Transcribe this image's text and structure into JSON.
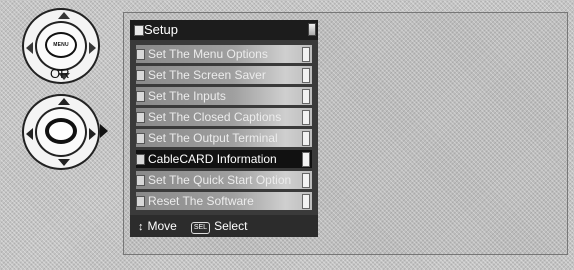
{
  "remote": {
    "top_button_label": "MENU",
    "or_label": "OR"
  },
  "menu": {
    "title": "Setup",
    "items": [
      {
        "label": "Set The Menu Options",
        "selected": false
      },
      {
        "label": "Set The Screen Saver",
        "selected": false
      },
      {
        "label": "Set The Inputs",
        "selected": false
      },
      {
        "label": "Set The Closed Captions",
        "selected": false
      },
      {
        "label": "Set The Output Terminal",
        "selected": false
      },
      {
        "label": "CableCARD Information",
        "selected": true
      },
      {
        "label": "Set The Quick Start Option",
        "selected": false
      },
      {
        "label": "Reset The Software",
        "selected": false
      }
    ],
    "footer": {
      "move_icon": "↕",
      "move_label": "Move",
      "sel_key": "SEL",
      "select_label": "Select"
    }
  }
}
